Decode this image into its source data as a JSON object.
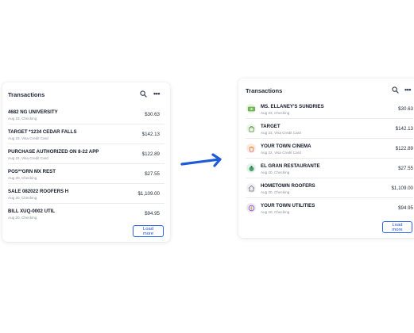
{
  "before": {
    "title": "Transactions",
    "load_more": "Load more",
    "rows": [
      {
        "merchant": "4682 NG UNIVERSITY",
        "sub": "Aug 23, Checking",
        "amount": "$30.63"
      },
      {
        "merchant": "TARGET *1234 CEDAR FALLS",
        "sub": "Aug 23, Visa Credit Card",
        "amount": "$142.13"
      },
      {
        "merchant": "PURCHASE AUTHORIZED ON 8-22 APP",
        "sub": "Aug 22, Visa Credit Card",
        "amount": "$122.89"
      },
      {
        "merchant": "POS**GRN MX REST",
        "sub": "Aug 20, Checking",
        "amount": "$27.55"
      },
      {
        "merchant": "SALE 082022 ROOFERS H",
        "sub": "Aug 20, Checking",
        "amount": "$1,109.00"
      },
      {
        "merchant": "BILL XUQ-0002 UTIL",
        "sub": "Aug 20, Checking",
        "amount": "$94.95"
      }
    ]
  },
  "after": {
    "title": "Transactions",
    "load_more": "Load more",
    "rows": [
      {
        "merchant": "MS. ELLANEY'S SUNDRIES",
        "sub": "Aug 23, Checking",
        "amount": "$30.63",
        "icon": "cash-icon"
      },
      {
        "merchant": "TARGET",
        "sub": "Aug 23, Visa Credit Card",
        "amount": "$142.13",
        "icon": "shopping-bag-icon"
      },
      {
        "merchant": "YOUR TOWN CINEMA",
        "sub": "Aug 22, Visa Credit Card",
        "amount": "$122.89",
        "icon": "popcorn-icon"
      },
      {
        "merchant": "EL GRAN RESTAURANTE",
        "sub": "Aug 20, Checking",
        "amount": "$27.55",
        "icon": "restaurant-icon"
      },
      {
        "merchant": "HOMETOWN ROOFERS",
        "sub": "Aug 20, Checking",
        "amount": "$1,109.00",
        "icon": "house-icon"
      },
      {
        "merchant": "YOUR TOWN UTILITIES",
        "sub": "Aug 20, Checking",
        "amount": "$94.95",
        "icon": "utilities-icon"
      }
    ]
  },
  "colors": {
    "accent": "#2563eb",
    "arrow": "#1e5bd8"
  }
}
